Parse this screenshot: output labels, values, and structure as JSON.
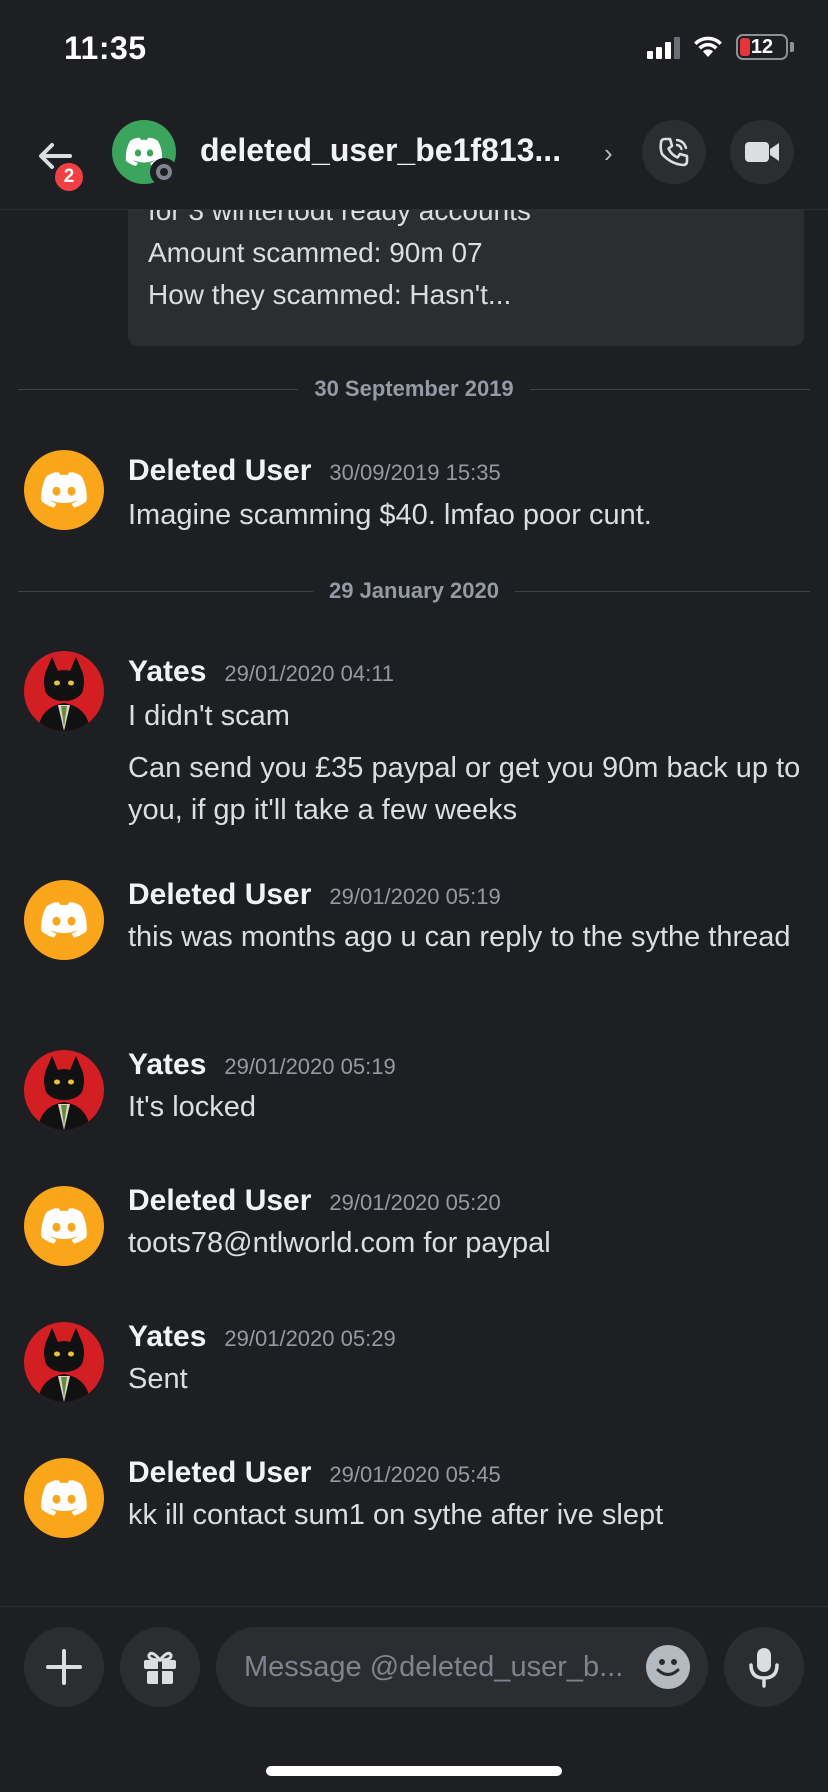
{
  "status_bar": {
    "time": "11:35",
    "battery": "12"
  },
  "header": {
    "title": "deleted_user_be1f813...",
    "unread_badge": "2",
    "avatar_color": "#3ba55d"
  },
  "embed": {
    "lines": [
      "for 3 wintertodt ready accounts",
      "Amount scammed: 90m 07",
      "How they scammed: Hasn't..."
    ]
  },
  "dividers": [
    "30 September 2019",
    "29 January 2020"
  ],
  "messages": [
    {
      "author": "Deleted User",
      "timestamp": "30/09/2019 15:35",
      "avatar": "discord-logo-icon",
      "text": [
        "Imagine scamming $40. lmfao poor cunt."
      ]
    },
    {
      "author": "Yates",
      "timestamp": "29/01/2020 04:11",
      "avatar": "cat-avatar",
      "text": [
        "I didn't scam",
        "Can send you £35 paypal or get you 90m back up to you, if gp it'll take a few weeks"
      ]
    },
    {
      "author": "Deleted User",
      "timestamp": "29/01/2020 05:19",
      "avatar": "discord-logo-icon",
      "text": [
        "this was months ago u can reply to the sythe thread"
      ]
    },
    {
      "author": "Yates",
      "timestamp": "29/01/2020 05:19",
      "avatar": "cat-avatar",
      "text": [
        "It's locked"
      ]
    },
    {
      "author": "Deleted User",
      "timestamp": "29/01/2020 05:20",
      "avatar": "discord-logo-icon",
      "text": [
        "toots78@ntlworld.com for paypal"
      ]
    },
    {
      "author": "Yates",
      "timestamp": "29/01/2020 05:29",
      "avatar": "cat-avatar",
      "text": [
        "Sent"
      ]
    },
    {
      "author": "Deleted User",
      "timestamp": "29/01/2020 05:45",
      "avatar": "discord-logo-icon",
      "text": [
        "kk ill contact sum1 on sythe after ive slept"
      ]
    }
  ],
  "composer": {
    "placeholder": "Message @deleted_user_b..."
  },
  "colors": {
    "background": "#1e1f22",
    "discord_orange": "#faa61a",
    "badge_red": "#f23f43",
    "cat_red": "#d31e24"
  }
}
